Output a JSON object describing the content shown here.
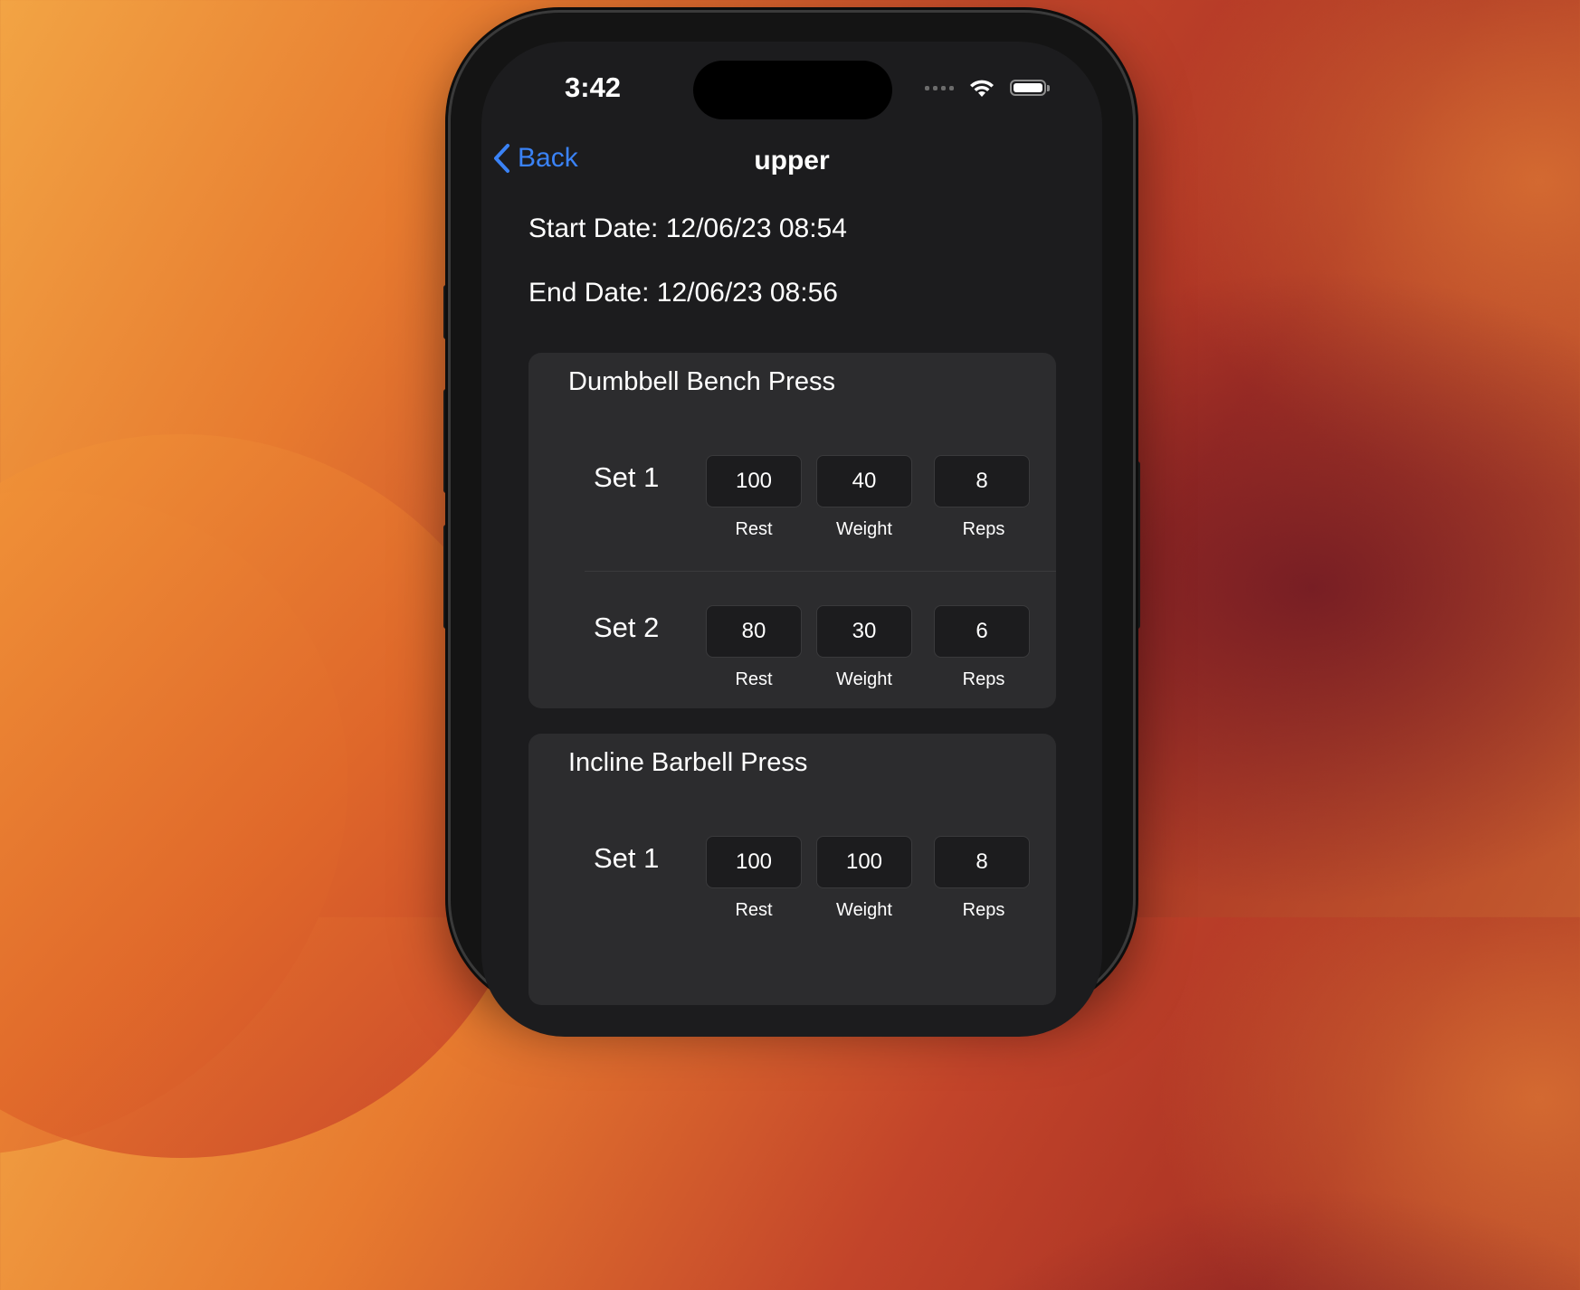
{
  "status_bar": {
    "time": "3:42"
  },
  "nav": {
    "back_label": "Back",
    "title": "upper"
  },
  "workout": {
    "start_date": "Start Date: 12/06/23 08:54",
    "end_date": "End Date: 12/06/23 08:56"
  },
  "exercises": [
    {
      "name": "Dumbbell Bench Press",
      "sets": [
        {
          "label": "Set 1",
          "rest": "100",
          "weight": "40",
          "reps": "8"
        },
        {
          "label": "Set 2",
          "rest": "80",
          "weight": "30",
          "reps": "6"
        }
      ]
    },
    {
      "name": "Incline Barbell Press",
      "sets": [
        {
          "label": "Set 1",
          "rest": "100",
          "weight": "100",
          "reps": "8"
        }
      ]
    }
  ],
  "field_labels": {
    "rest": "Rest",
    "weight": "Weight",
    "reps": "Reps"
  },
  "colors": {
    "accent": "#3a82f6",
    "background": "#1c1c1e",
    "card": "#2c2c2e"
  },
  "icons": {
    "back": "chevron-left-icon",
    "wifi": "wifi-icon",
    "battery": "battery-icon",
    "cellular": "cellular-signal-icon"
  }
}
